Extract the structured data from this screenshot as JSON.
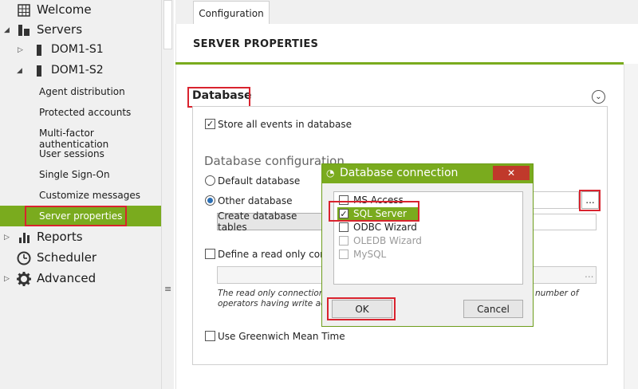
{
  "sidebar": {
    "items": [
      {
        "label": "Welcome",
        "icon": "grid-icon"
      },
      {
        "label": "Servers",
        "icon": "servers-icon"
      },
      {
        "label": "DOM1-S1",
        "icon": "server-icon"
      },
      {
        "label": "DOM1-S2",
        "icon": "server-icon"
      },
      {
        "label": "Agent distribution"
      },
      {
        "label": "Protected accounts"
      },
      {
        "label": "Multi-factor authentication"
      },
      {
        "label": "User sessions"
      },
      {
        "label": "Single Sign-On"
      },
      {
        "label": "Customize messages"
      },
      {
        "label": "Server properties"
      },
      {
        "label": "Reports",
        "icon": "bar-chart-icon"
      },
      {
        "label": "Scheduler",
        "icon": "clock-icon"
      },
      {
        "label": "Advanced",
        "icon": "gear-icon"
      }
    ],
    "grip": "≡"
  },
  "tab": {
    "label": "Configuration"
  },
  "page": {
    "title": "SERVER PROPERTIES"
  },
  "database": {
    "header": "Database",
    "store_events": "Store all events in database",
    "config_title": "Database configuration",
    "default_db": "Default database",
    "other_db": "Other database",
    "create_tables": "Create database tables",
    "readonly_conn": "Define a read only connection",
    "ellipsis": "...",
    "note_line1": "The read only connection s",
    "note_line1_end": "number of",
    "note_line2": "operators having write acce",
    "gmt": "Use Greenwich Mean Time"
  },
  "dialog": {
    "title": "Database connection",
    "close": "✕",
    "options": [
      {
        "label": "MS Access",
        "checked": false,
        "selected": false,
        "enabled": true
      },
      {
        "label": "SQL Server",
        "checked": true,
        "selected": true,
        "enabled": true
      },
      {
        "label": "ODBC Wizard",
        "checked": false,
        "selected": false,
        "enabled": true
      },
      {
        "label": "OLEDB Wizard",
        "checked": false,
        "selected": false,
        "enabled": false
      },
      {
        "label": "MySQL",
        "checked": false,
        "selected": false,
        "enabled": false
      }
    ],
    "ok": "OK",
    "cancel": "Cancel"
  },
  "colors": {
    "accent": "#7aab1e",
    "highlight": "#d9232e",
    "close": "#c0392b"
  }
}
